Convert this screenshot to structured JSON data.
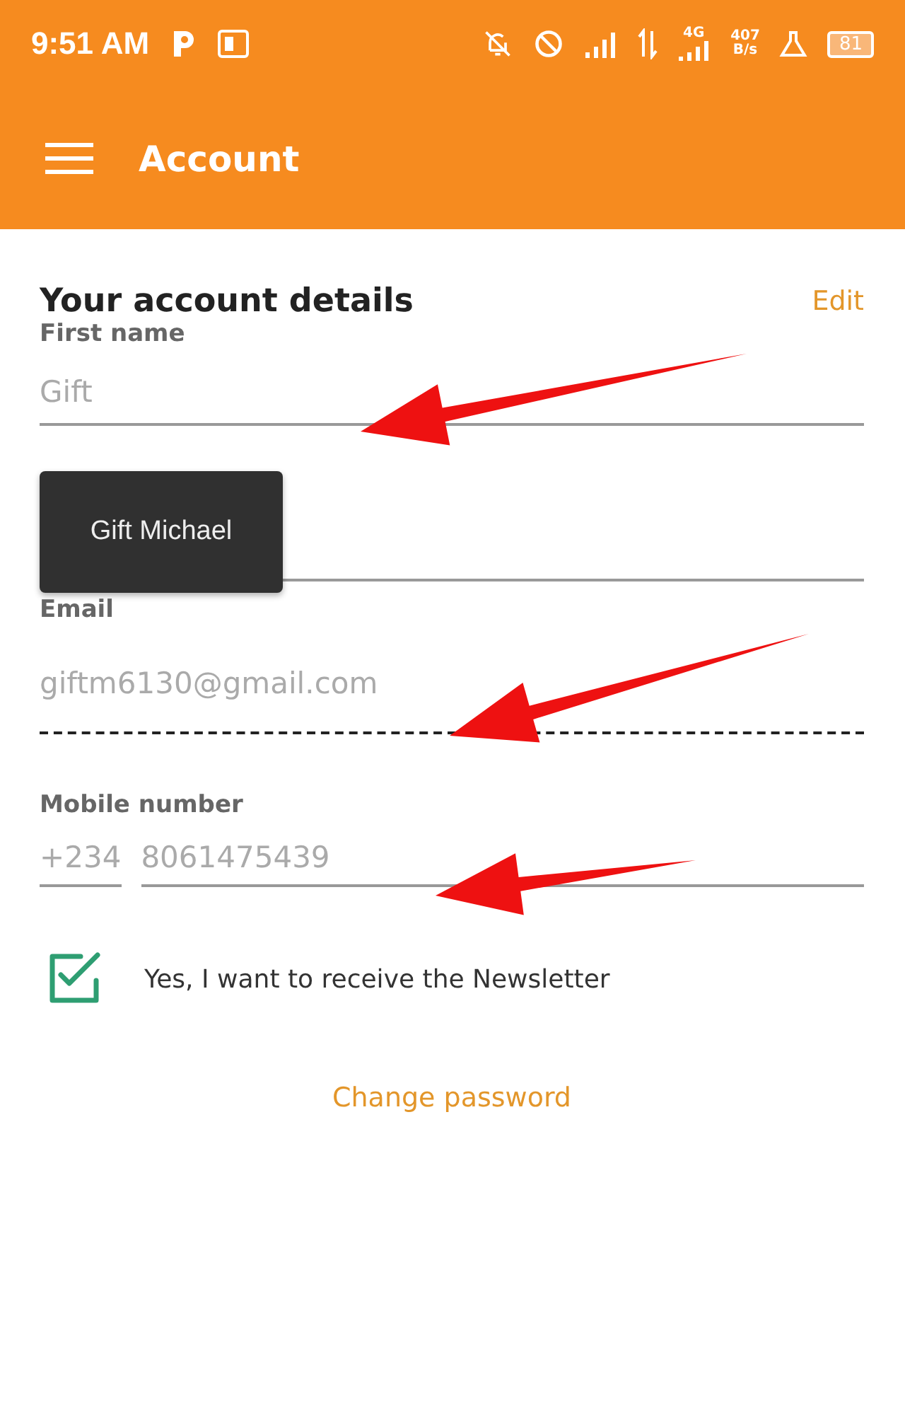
{
  "status_bar": {
    "time": "9:51 AM",
    "network": "4G",
    "speed_value": "407",
    "speed_unit": "B/s",
    "battery": "81"
  },
  "app_bar": {
    "title": "Account"
  },
  "section": {
    "title": "Your account details",
    "action": "Edit"
  },
  "fields": [
    {
      "kind": "text",
      "label": "First name",
      "value": "Gift",
      "disabled": false
    },
    {
      "kind": "hidden",
      "disabled": false
    },
    {
      "kind": "text",
      "label": "Email",
      "value": "giftm6130@gmail.com",
      "disabled": true
    },
    {
      "kind": "phone",
      "label": "Mobile number",
      "prefix": "+234",
      "value": "8061475439",
      "disabled": false
    }
  ],
  "tooltip": {
    "text": "Gift Michael"
  },
  "newsletter": {
    "label": "Yes, I want to receive the Newsletter",
    "checked": true
  },
  "link": "Change password"
}
